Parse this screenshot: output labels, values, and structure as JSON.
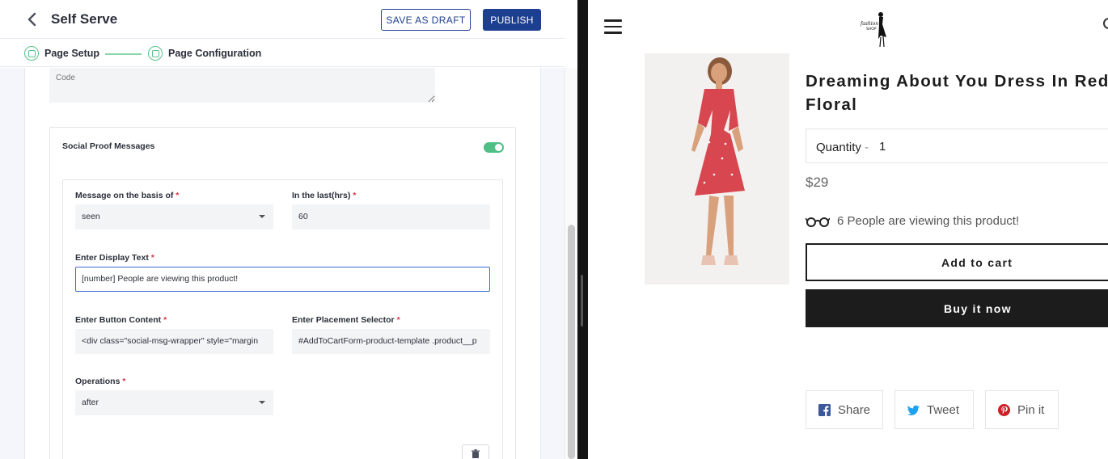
{
  "editor": {
    "title": "Self Serve",
    "save_draft_label": "SAVE AS DRAFT",
    "publish_label": "PUBLISH",
    "steps": [
      {
        "label": "Page Setup"
      },
      {
        "label": "Page Configuration"
      }
    ],
    "code_placeholder": "Code",
    "social_proof": {
      "title": "Social Proof Messages",
      "enabled": true,
      "message_basis_label": "Message on the basis of",
      "message_basis_value": "seen",
      "last_hrs_label": "In the last(hrs)",
      "last_hrs_value": "60",
      "display_text_label": "Enter Display Text",
      "display_text_value": "[number] People are viewing this product!",
      "button_content_label": "Enter Button Content",
      "button_content_value": "<div class=\"social-msg-wrapper\" style=\"margin",
      "placement_selector_label": "Enter Placement Selector",
      "placement_selector_value": "#AddToCartForm-product-template .product__p",
      "operations_label": "Operations",
      "operations_value": "after",
      "required_mark": "*"
    }
  },
  "store": {
    "logo_text": "fashion SHOP",
    "product_title": "Dreaming About You Dress In Red Floral",
    "quantity_label": "Quantity",
    "quantity_separator": "-",
    "quantity_value": "1",
    "price": "$29",
    "viewers_text": "6 People are viewing this product!",
    "add_to_cart_label": "Add to cart",
    "buy_now_label": "Buy it now",
    "share": [
      {
        "label": "Share",
        "icon": "facebook-icon"
      },
      {
        "label": "Tweet",
        "icon": "twitter-icon"
      },
      {
        "label": "Pin it",
        "icon": "pinterest-icon"
      }
    ]
  },
  "colors": {
    "primary": "#1d3f8f",
    "success": "#4fbf85",
    "required": "#d9364a",
    "dark": "#1c1c1c",
    "facebook": "#3b5998",
    "twitter": "#1da1f2",
    "pinterest": "#cb2027"
  }
}
